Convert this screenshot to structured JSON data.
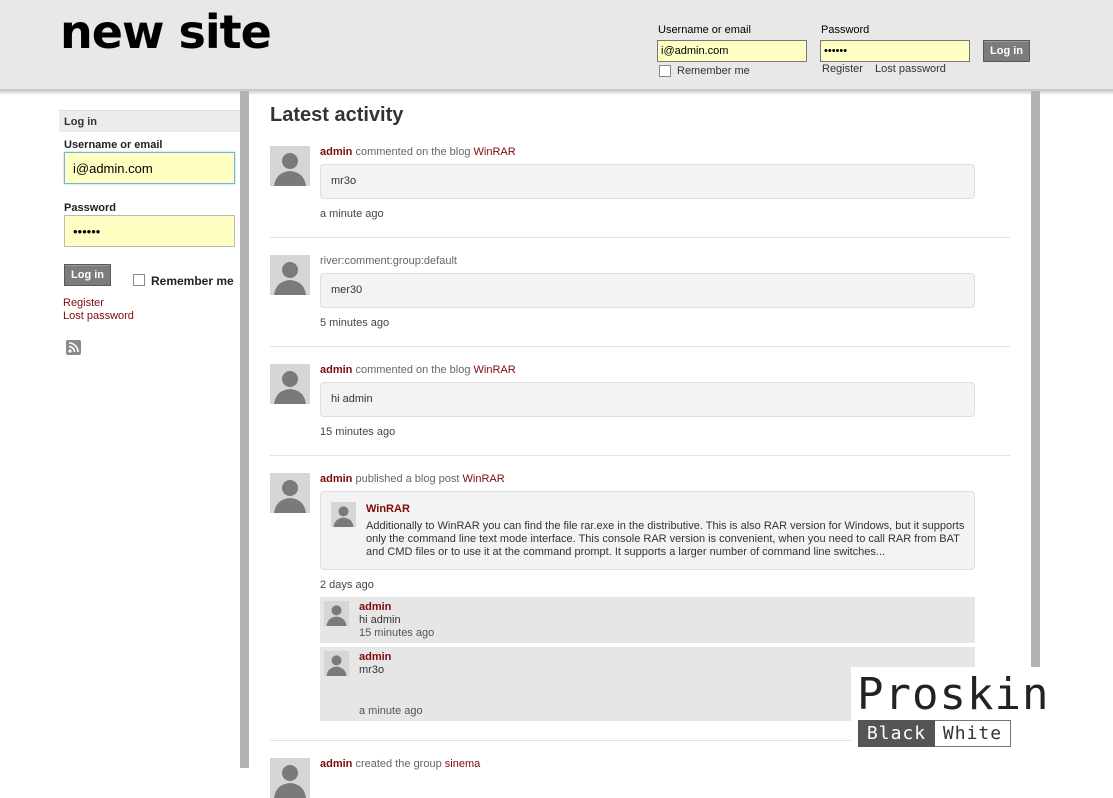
{
  "header": {
    "site_title": "new site",
    "username_label": "Username or email",
    "username_value": "i@admin.com",
    "password_label": "Password",
    "password_value": "••••••",
    "login_button": "Log in",
    "remember_label": "Remember me",
    "register_link": "Register",
    "lost_password_link": "Lost password"
  },
  "sidebar": {
    "title": "Log in",
    "username_label": "Username or email",
    "username_value": "i@admin.com",
    "password_label": "Password",
    "password_value": "••••••",
    "login_button": "Log in",
    "remember_label": "Remember me",
    "register_link": "Register",
    "lost_password_link": "Lost password",
    "rss_icon": "rss-icon"
  },
  "main": {
    "title": "Latest activity",
    "items": [
      {
        "user": "admin",
        "action": "commented on the blog",
        "target": "WinRAR",
        "bubble_text": "mr3o",
        "time": "a minute ago"
      },
      {
        "user": "",
        "action": "river:comment:group:default",
        "target": "",
        "bubble_text": "mer30",
        "time": "5 minutes ago"
      },
      {
        "user": "admin",
        "action": "commented on the blog",
        "target": "WinRAR",
        "bubble_text": "hi admin",
        "time": "15 minutes ago"
      },
      {
        "user": "admin",
        "action": "published a blog post",
        "target": "WinRAR",
        "post_title": "WinRAR",
        "post_excerpt": "Additionally to WinRAR you can find the file rar.exe in the distributive. This is also RAR version for Windows, but it supports only the command line text mode interface. This console RAR version is convenient, when you need to call RAR from BAT and CMD files or to use it at the command prompt. It supports a larger number of command line switches...",
        "time": "2 days ago",
        "comments": [
          {
            "author": "admin",
            "text": "hi admin",
            "time": "15 minutes ago"
          },
          {
            "author": "admin",
            "text": "mr3o",
            "time": "a minute ago"
          }
        ]
      },
      {
        "user": "admin",
        "action": "created the group",
        "target": "sinema"
      }
    ]
  },
  "watermark": {
    "word": "Proskin",
    "black_label": "Black",
    "white_label": "White"
  },
  "colors": {
    "link_accent": "#7d0a0a",
    "input_background": "#ffffc4",
    "header_background": "#e8e8e8",
    "button_background": "#7c7c7c"
  }
}
